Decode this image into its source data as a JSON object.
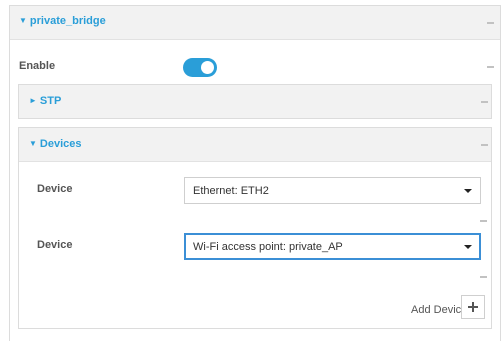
{
  "bridge": {
    "title": "private_bridge",
    "expanded_glyph": "▼",
    "enable_label": "Enable",
    "enable_on": true
  },
  "stp": {
    "title": "STP",
    "collapsed_glyph": "►"
  },
  "devices": {
    "title": "Devices",
    "expanded_glyph": "▼",
    "rows": [
      {
        "label": "Device",
        "value": "Ethernet: ETH2"
      },
      {
        "label": "Device",
        "value": "Wi-Fi access point: private_AP"
      }
    ],
    "add_label": "Add Device"
  },
  "colors": {
    "accent": "#2a9ed8",
    "header_bg": "#f2f2f2"
  },
  "icons": {
    "menu": "dash-icon",
    "add": "plus-icon",
    "dropdown": "caret-down-icon"
  }
}
